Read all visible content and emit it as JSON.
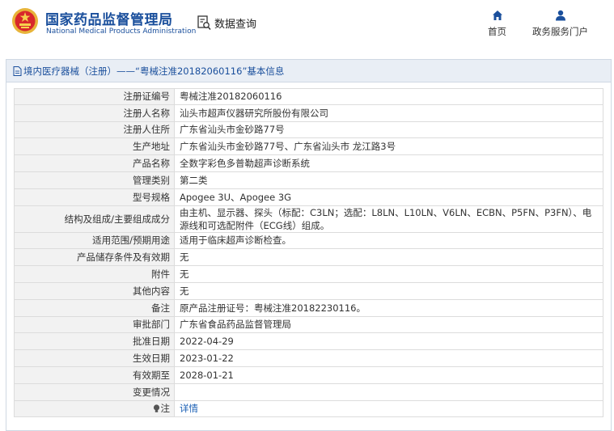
{
  "header": {
    "brand_cn": "国家药品监督管理局",
    "brand_en": "National Medical Products Administration",
    "query_label": "数据查询",
    "nav": {
      "home": "首页",
      "portal": "政务服务门户"
    }
  },
  "panel": {
    "title": "境内医疗器械（注册）——“粤械注准20182060116”基本信息"
  },
  "rows": [
    {
      "label": "注册证编号",
      "value": "粤械注准20182060116"
    },
    {
      "label": "注册人名称",
      "value": "汕头市超声仪器研究所股份有限公司"
    },
    {
      "label": "注册人住所",
      "value": "广东省汕头市金砂路77号"
    },
    {
      "label": "生产地址",
      "value": "广东省汕头市金砂路77号、广东省汕头市 龙江路3号"
    },
    {
      "label": "产品名称",
      "value": "全数字彩色多普勒超声诊断系统"
    },
    {
      "label": "管理类别",
      "value": "第二类"
    },
    {
      "label": "型号规格",
      "value": "Apogee 3U、Apogee 3G"
    },
    {
      "label": "结构及组成/主要组成成分",
      "value": "由主机、显示器、探头（标配：C3LN；选配：L8LN、L10LN、V6LN、ECBN、P5FN、P3FN）、电源线和可选配附件（ECG线）组成。"
    },
    {
      "label": "适用范围/预期用途",
      "value": "适用于临床超声诊断检查。"
    },
    {
      "label": "产品储存条件及有效期",
      "value": "无"
    },
    {
      "label": "附件",
      "value": "无"
    },
    {
      "label": "其他内容",
      "value": "无"
    },
    {
      "label": "备注",
      "value": "原产品注册证号：粤械注准20182230116。"
    },
    {
      "label": "审批部门",
      "value": "广东省食品药品监督管理局"
    },
    {
      "label": "批准日期",
      "value": "2022-04-29"
    },
    {
      "label": "生效日期",
      "value": "2023-01-22"
    },
    {
      "label": "有效期至",
      "value": "2028-01-21"
    },
    {
      "label": "变更情况",
      "value": ""
    },
    {
      "label": "注",
      "value": "详情"
    }
  ],
  "colors": {
    "brand_blue": "#1a4f9c",
    "link_blue": "#1a5fb4",
    "label_bg": "#f2f2f2",
    "title_bar_bg": "#e9eef5"
  }
}
